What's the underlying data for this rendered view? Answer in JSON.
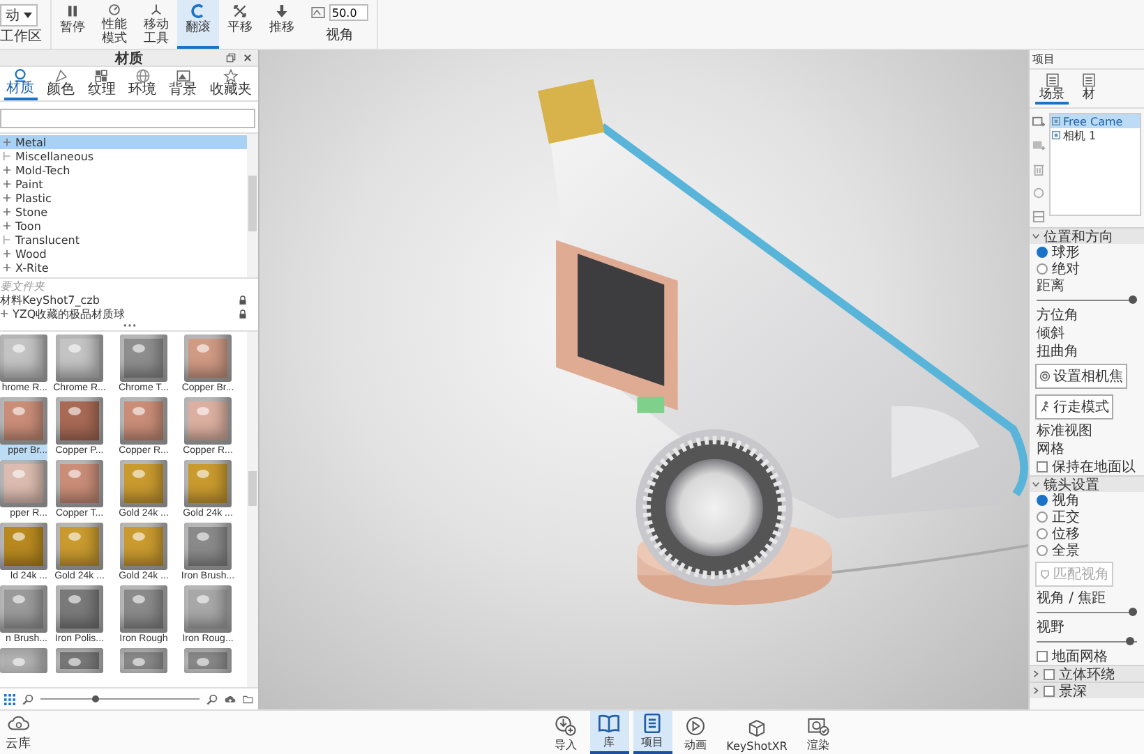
{
  "toolbar": {
    "dropdown": {
      "value": "动",
      "label": "工作区"
    },
    "tools": [
      {
        "lines": [
          "暂停"
        ],
        "selected": false
      },
      {
        "lines": [
          "性能",
          "模式"
        ],
        "selected": false
      },
      {
        "lines": [
          "移动",
          "工具"
        ],
        "selected": false
      },
      {
        "lines": [
          "翻滚"
        ],
        "selected": true
      },
      {
        "lines": [
          "平移"
        ],
        "selected": false
      },
      {
        "lines": [
          "推移"
        ],
        "selected": false
      }
    ],
    "view": {
      "value": "50.0",
      "label": "视角"
    }
  },
  "library": {
    "title": "材质",
    "tabs": [
      {
        "label": "材质",
        "selected": true
      },
      {
        "label": "颜色",
        "selected": false
      },
      {
        "label": "纹理",
        "selected": false
      },
      {
        "label": "环境",
        "selected": false
      },
      {
        "label": "背景",
        "selected": false
      },
      {
        "label": "收藏夹",
        "selected": false
      }
    ],
    "tree": [
      {
        "label": "Metal",
        "expandable": true,
        "selected": true
      },
      {
        "label": "Miscellaneous",
        "expandable": false,
        "selected": false
      },
      {
        "label": "Mold-Tech",
        "expandable": true,
        "selected": false
      },
      {
        "label": "Paint",
        "expandable": true,
        "selected": false
      },
      {
        "label": "Plastic",
        "expandable": true,
        "selected": false
      },
      {
        "label": "Stone",
        "expandable": true,
        "selected": false
      },
      {
        "label": "Toon",
        "expandable": true,
        "selected": false
      },
      {
        "label": "Translucent",
        "expandable": false,
        "selected": false
      },
      {
        "label": "Wood",
        "expandable": true,
        "selected": false
      },
      {
        "label": "X-Rite",
        "expandable": true,
        "selected": false
      }
    ],
    "folders": [
      {
        "kind": "header",
        "label": "要文件夹"
      },
      {
        "kind": "folder",
        "label": "材料KeyShot7_czb",
        "expandable": false,
        "locked": true
      },
      {
        "kind": "folder",
        "label": "YZQ收藏的极品材质球",
        "expandable": true,
        "locked": true
      }
    ],
    "materials": [
      {
        "label": "hrome R...",
        "color": "#c4c4c4",
        "selected": false
      },
      {
        "label": "Chrome R...",
        "color": "#c4c4c4",
        "selected": false
      },
      {
        "label": "Chrome T...",
        "color": "#8e8e8e",
        "selected": false
      },
      {
        "label": "Copper Br...",
        "color": "#d09a84",
        "selected": false
      },
      {
        "label": "pper Br...",
        "color": "#c98d78",
        "selected": true
      },
      {
        "label": "Copper P...",
        "color": "#a86a55",
        "selected": false
      },
      {
        "label": "Copper R...",
        "color": "#c98d78",
        "selected": false
      },
      {
        "label": "Copper R...",
        "color": "#dcb0a0",
        "selected": false
      },
      {
        "label": "pper R...",
        "color": "#dcbcb0",
        "selected": false
      },
      {
        "label": "Copper T...",
        "color": "#c98d78",
        "selected": false
      },
      {
        "label": "Gold 24k ...",
        "color": "#c99a2e",
        "selected": false
      },
      {
        "label": "Gold 24k ...",
        "color": "#c99a2e",
        "selected": false
      },
      {
        "label": "ld 24k ...",
        "color": "#b8891f",
        "selected": false
      },
      {
        "label": "Gold 24k ...",
        "color": "#c99a2e",
        "selected": false
      },
      {
        "label": "Gold 24k ...",
        "color": "#c99a2e",
        "selected": false
      },
      {
        "label": "Iron Brush...",
        "color": "#8a8a8a",
        "selected": false
      },
      {
        "label": "n Brush...",
        "color": "#9a9a9a",
        "selected": false
      },
      {
        "label": "Iron Polis...",
        "color": "#7a7a7a",
        "selected": false
      },
      {
        "label": "Iron Rough",
        "color": "#8a8a8a",
        "selected": false
      },
      {
        "label": "Iron Roug...",
        "color": "#a8a8a8",
        "selected": false
      },
      {
        "color": "#b4b4b4",
        "selected": false
      },
      {
        "color": "#7a7a7a",
        "selected": false
      },
      {
        "color": "#8a8a8a",
        "selected": false
      },
      {
        "color": "#8a8a8a",
        "selected": false
      }
    ],
    "thumb_size": {
      "level": 0.35
    }
  },
  "project": {
    "title": "项目",
    "tabs": [
      {
        "label": "场景",
        "selected": true
      },
      {
        "label": "材",
        "selected": false
      }
    ],
    "cameras": [
      {
        "label": "Free Came",
        "selected": true
      },
      {
        "label": "相机 1",
        "selected": false
      }
    ],
    "sections": [
      {
        "title": "位置和方向",
        "expanded": true,
        "rows": [
          {
            "kind": "radio",
            "label": "球形",
            "checked": true
          },
          {
            "kind": "radio",
            "label": "绝对",
            "checked": false
          },
          {
            "kind": "label",
            "label": "距离"
          },
          {
            "kind": "slider",
            "level": 0.96
          },
          {
            "kind": "label",
            "label": "方位角"
          },
          {
            "kind": "label",
            "label": "倾斜"
          },
          {
            "kind": "label",
            "label": "扭曲角"
          },
          {
            "kind": "button",
            "label": "设置相机焦",
            "disabled": false
          },
          {
            "kind": "button",
            "label": "行走模式",
            "disabled": false
          },
          {
            "kind": "label",
            "label": "标准视图"
          },
          {
            "kind": "label",
            "label": "网格"
          },
          {
            "kind": "checkbox",
            "label": "保持在地面以",
            "checked": false
          }
        ]
      },
      {
        "title": "镜头设置",
        "expanded": true,
        "rows": [
          {
            "kind": "radio",
            "label": "视角",
            "checked": true
          },
          {
            "kind": "radio",
            "label": "正交",
            "checked": false
          },
          {
            "kind": "radio",
            "label": "位移",
            "checked": false
          },
          {
            "kind": "radio",
            "label": "全景",
            "checked": false
          },
          {
            "kind": "button",
            "label": "匹配视角",
            "disabled": true
          },
          {
            "kind": "label",
            "label": "视角 / 焦距"
          },
          {
            "kind": "slider",
            "level": 0.96
          },
          {
            "kind": "label",
            "label": "视野"
          },
          {
            "kind": "slider",
            "level": 0.93
          },
          {
            "kind": "checkbox",
            "label": "地面网格",
            "checked": false
          }
        ]
      },
      {
        "title": "立体环绕",
        "expanded": false,
        "checked": false
      },
      {
        "title": "景深",
        "expanded": false,
        "checked": false
      }
    ]
  },
  "bottom": {
    "cloud": {
      "label": "云库"
    },
    "dock": [
      {
        "label": "导入",
        "selected": false
      },
      {
        "label": "库",
        "selected": true
      },
      {
        "label": "项目",
        "selected": true
      },
      {
        "label": "动画",
        "selected": false
      },
      {
        "label": "KeyShotXR",
        "selected": false
      },
      {
        "label": "渲染",
        "selected": false
      }
    ]
  }
}
